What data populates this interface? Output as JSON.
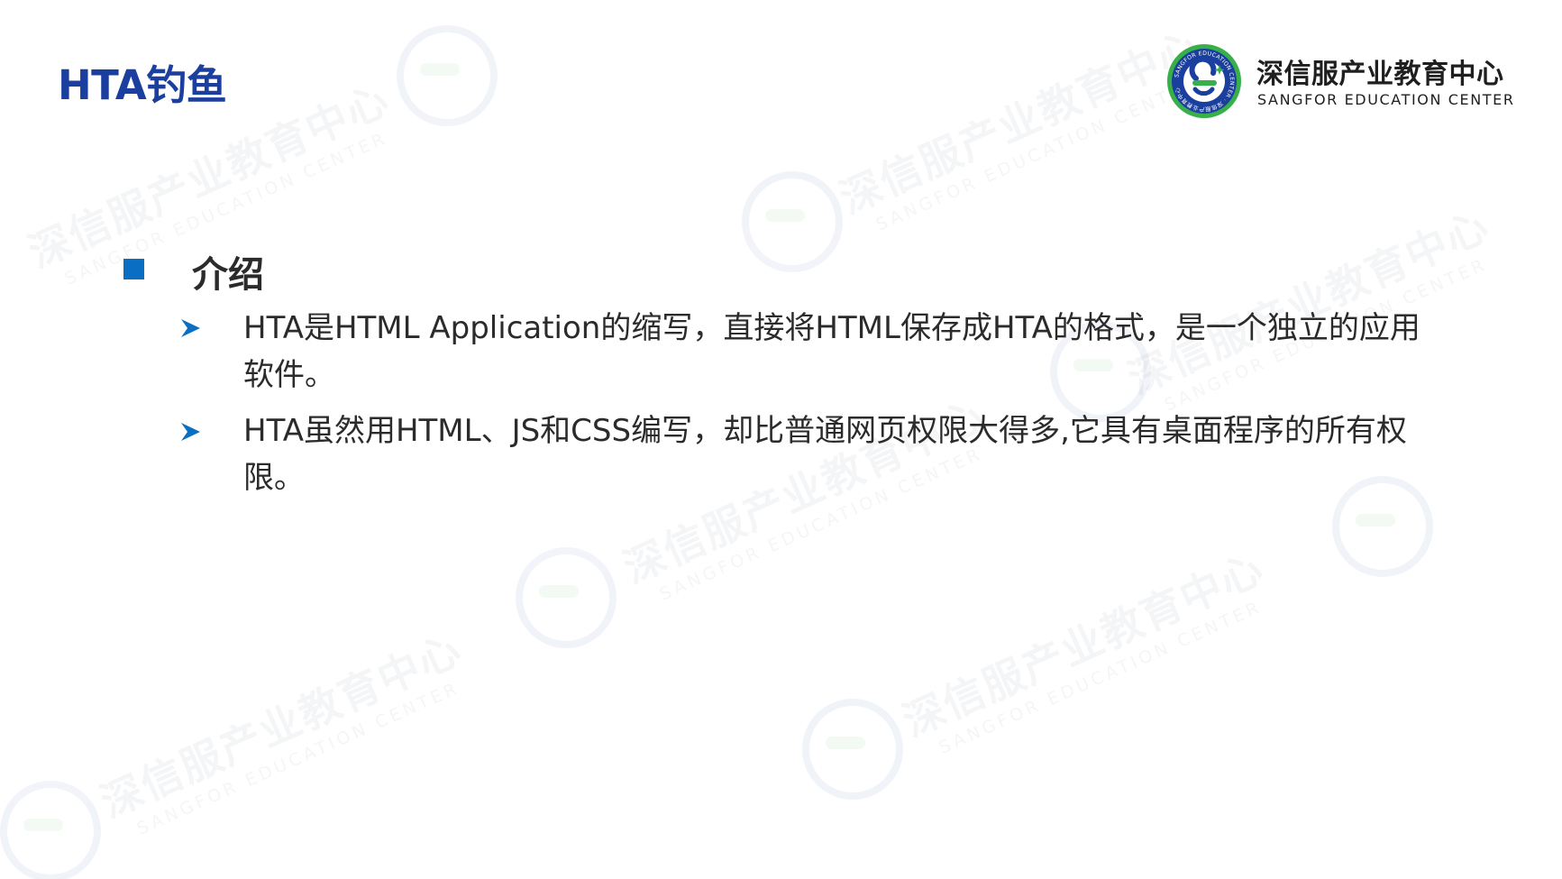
{
  "slide": {
    "title": "HTA钓鱼"
  },
  "logo": {
    "name_cn": "深信服产业教育中心",
    "name_en": "SANGFOR EDUCATION CENTER",
    "seal_text": "SANGFOR EDUCATION CENTER · 深信服产业教育中心",
    "colors": {
      "blue": "#1b3f9e",
      "green": "#38b04a"
    }
  },
  "watermark": {
    "text_cn": "深信服产业教育中心",
    "text_en": "SANGFOR EDUCATION CENTER"
  },
  "section": {
    "heading": "介绍",
    "items": [
      {
        "text": "HTA是HTML Application的缩写，直接将HTML保存成HTA的格式，是一个独立的应用软件。"
      },
      {
        "text": "HTA虽然用HTML、JS和CSS编写，却比普通网页权限大得多,它具有桌面程序的所有权限。"
      }
    ]
  },
  "colors": {
    "title": "#1b3f9e",
    "section_bullet": "#0a6fc2",
    "item_arrow": "#0a6fc2",
    "body_text": "#2b2b2b"
  }
}
